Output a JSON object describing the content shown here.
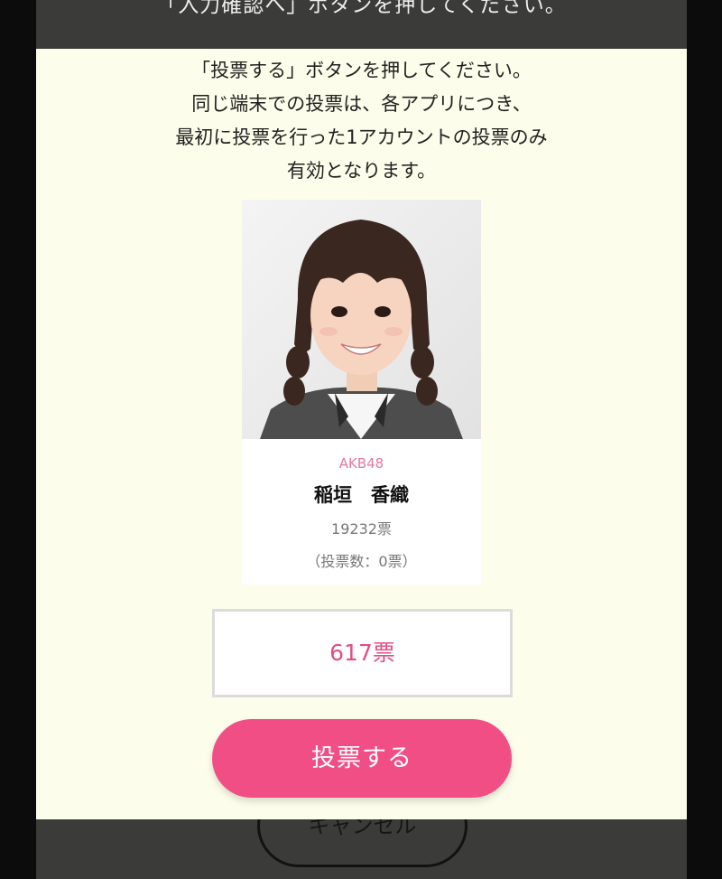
{
  "background": {
    "hint_text": "「入力確認へ」ボタンを押してください。",
    "cancel_label": "キャンセル"
  },
  "modal": {
    "instructions": [
      "「投票する」ボタンを押してください。",
      "同じ端末での投票は、各アプリにつき、",
      "最初に投票を行った1アカウントの投票のみ",
      "有効となります。"
    ],
    "member": {
      "group": "AKB48",
      "name": "稲垣　香織",
      "total_votes": "19232票",
      "my_votes": "（投票数：0票）"
    },
    "vote_amount": "617票",
    "vote_button_label": "投票する"
  },
  "colors": {
    "modal_bg": "#fdfdeb",
    "accent_pink": "#f24e86",
    "group_pink": "#e3799b",
    "overlay": "#3b3b39"
  }
}
